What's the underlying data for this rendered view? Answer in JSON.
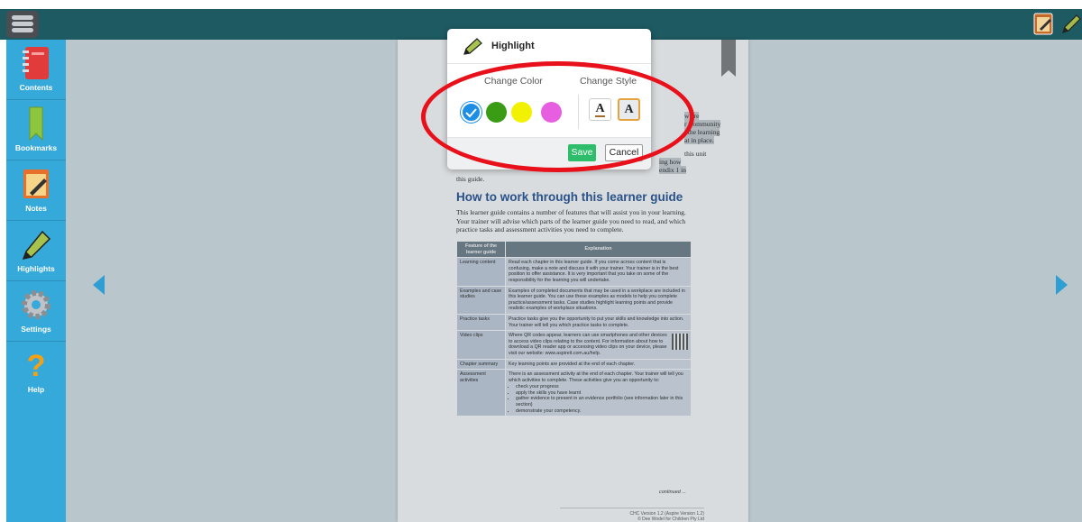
{
  "sidebar": {
    "items": [
      {
        "label": "Contents"
      },
      {
        "label": "Bookmarks"
      },
      {
        "label": "Notes"
      },
      {
        "label": "Highlights"
      },
      {
        "label": "Settings"
      },
      {
        "label": "Help"
      }
    ]
  },
  "dialog": {
    "title": "Highlight",
    "change_color_label": "Change Color",
    "change_style_label": "Change Style",
    "colors": [
      {
        "name": "blue",
        "hex": "#1d8ee6",
        "selected": true
      },
      {
        "name": "green",
        "hex": "#3a9b14",
        "selected": false
      },
      {
        "name": "yellow",
        "hex": "#f2f200",
        "selected": false
      },
      {
        "name": "pink",
        "hex": "#e75fe0",
        "selected": false
      }
    ],
    "styles": [
      {
        "letter": "A",
        "style": "underline",
        "selected": false
      },
      {
        "letter": "A",
        "style": "highlight",
        "selected": true
      }
    ],
    "save_label": "Save",
    "cancel_label": "Cancel"
  },
  "page": {
    "snippets": [
      "w are",
      "r Community",
      ", the learning",
      "at in place.",
      "this unit",
      "ing how",
      "endix 1 in",
      "this guide."
    ],
    "heading": "How to work through this learner guide",
    "intro": "This learner guide contains a number of features that will assist you in your learning. Your trainer will advise which parts of the learner guide you need to read, and which practice tasks and assessment activities you need to complete.",
    "table": {
      "headers": [
        "Feature of the learner guide",
        "Explanation"
      ],
      "rows": [
        {
          "feature": "Learning content",
          "explanation": "Read each chapter in this learner guide. If you come across content that is confusing, make a note and discuss it with your trainer. Your trainer is in the best position to offer assistance. It is very important that you take on some of the responsibility for the learning you will undertake."
        },
        {
          "feature": "Examples and case studies",
          "explanation": "Examples of completed documents that may be used in a workplace are included in this learner guide. You can use these examples as models to help you complete practice/assessment tasks. Case studies highlight learning points and provide realistic examples of workplace situations."
        },
        {
          "feature": "Practice tasks",
          "explanation": "Practice tasks give you the opportunity to put your skills and knowledge into action. Your trainer will tell you which practice tasks to complete."
        },
        {
          "feature": "Video clips",
          "explanation": "Where QR codes appear, learners can use smartphones and other devices to access video clips relating to the content. For information about how to download a QR reader app or accessing video clips on your device, please visit our website: www.aspireit.com.au/help."
        },
        {
          "feature": "Chapter summary",
          "explanation": "Key learning points are provided at the end of each chapter."
        },
        {
          "feature": "Assessment activities",
          "explanation": "There is an assessment activity at the end of each chapter. Your trainer will tell you which activities to complete. These activities give you an opportunity to:"
        }
      ],
      "bullets": [
        "check your progress",
        "apply the skills you have learnt",
        "gather evidence to present in an evidence portfolio (see information later in this section)",
        "demonstrate your competency."
      ]
    },
    "continued": "continued ...",
    "footer_line1": "CHC Version 1.2 (Aspire Version 1.2)",
    "footer_line2": "© Dee Wodel for Children Pty Ltd"
  },
  "colors": {
    "topbar": "#1e5a62",
    "sidebar": "#35a9da",
    "viewer_bg": "#b9c6cb",
    "annotation_ring": "#e8111b",
    "save_button": "#2ebd6b"
  },
  "icons": [
    "menu-icon",
    "notebook-icon",
    "bookmark-icon",
    "notes-icon",
    "highlighter-icon",
    "gear-icon",
    "question-icon",
    "pencil-icon",
    "checkmark-icon"
  ]
}
